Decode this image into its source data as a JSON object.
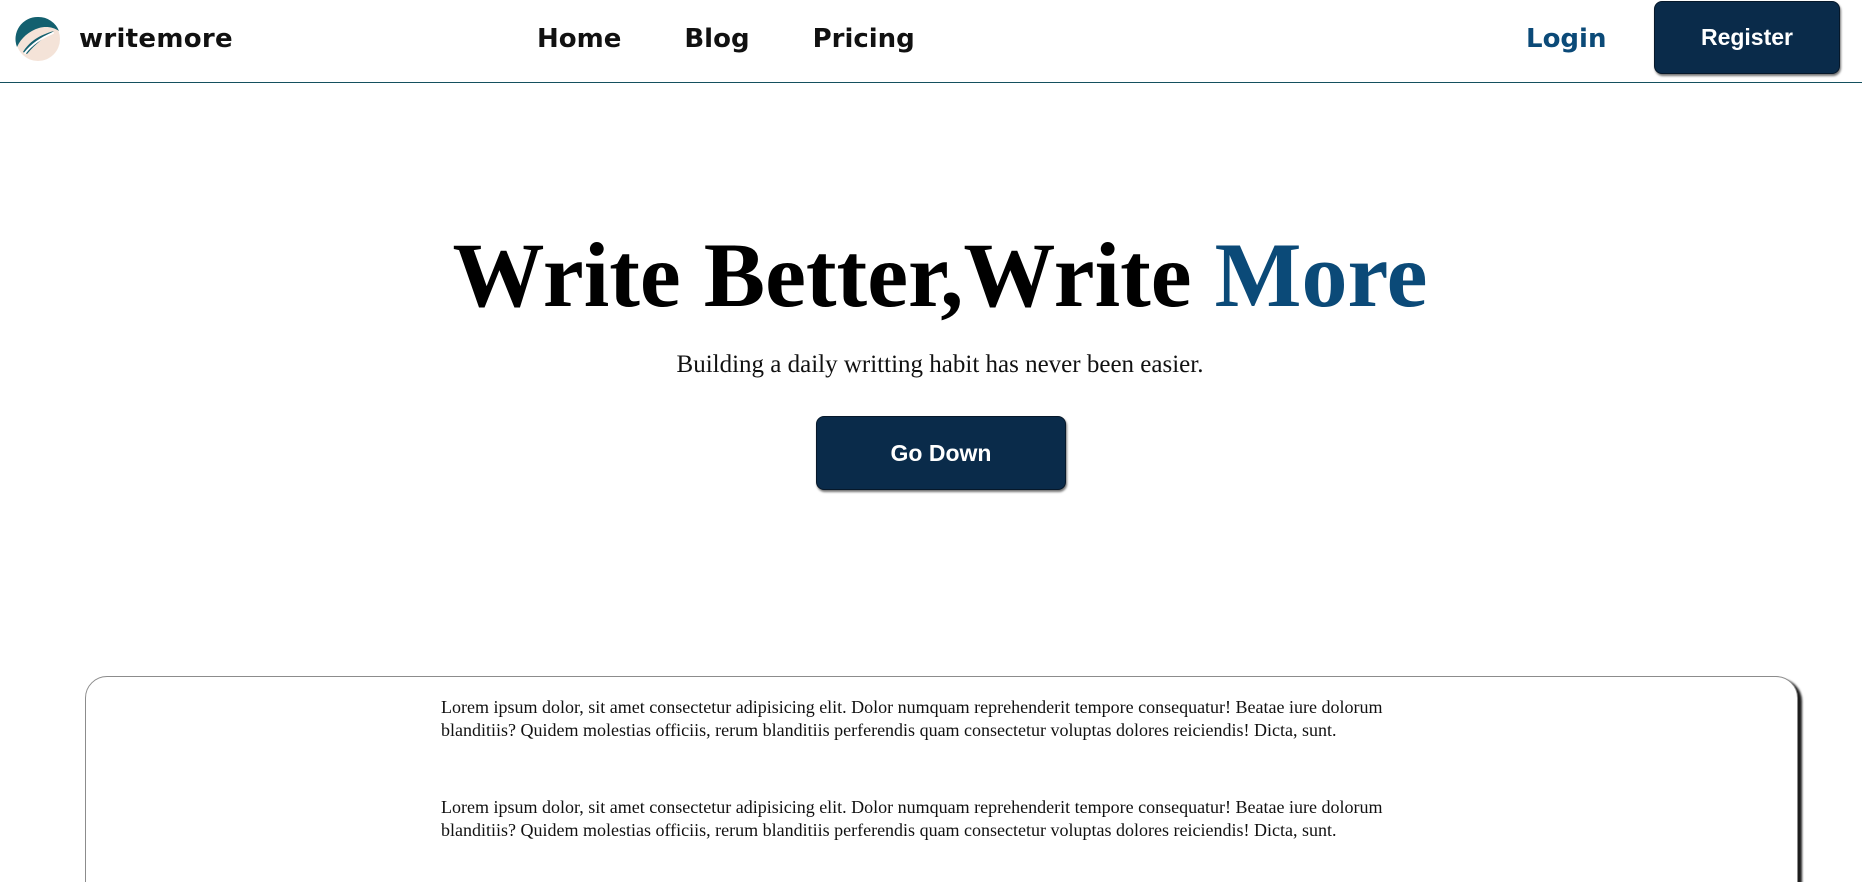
{
  "header": {
    "brand_name": "writemore",
    "nav": {
      "home": "Home",
      "blog": "Blog",
      "pricing": "Pricing"
    },
    "login_label": "Login",
    "register_label": "Register"
  },
  "hero": {
    "title_main": "Write Better,Write ",
    "title_accent": "More",
    "subtitle": "Building a daily writting habit has never been easier.",
    "cta_label": "Go Down"
  },
  "content": {
    "paragraphs": [
      "Lorem ipsum dolor, sit amet consectetur adipisicing elit. Dolor numquam reprehenderit tempore consequatur! Beatae iure dolorum blanditiis? Quidem molestias officiis, rerum blanditiis perferendis quam consectetur voluptas dolores reiciendis! Dicta, sunt.",
      "Lorem ipsum dolor, sit amet consectetur adipisicing elit. Dolor numquam reprehenderit tempore consequatur! Beatae iure dolorum blanditiis? Quidem molestias officiis, rerum blanditiis perferendis quam consectetur voluptas dolores reiciendis! Dicta, sunt."
    ]
  },
  "colors": {
    "primary_dark": "#0a2b4a",
    "accent_blue": "#0b4a78",
    "header_border": "#14505e",
    "logo_teal": "#13606f",
    "logo_cream": "#f4e3d8"
  },
  "icons": {
    "brand_logo": "feather-quill-logo-icon"
  }
}
